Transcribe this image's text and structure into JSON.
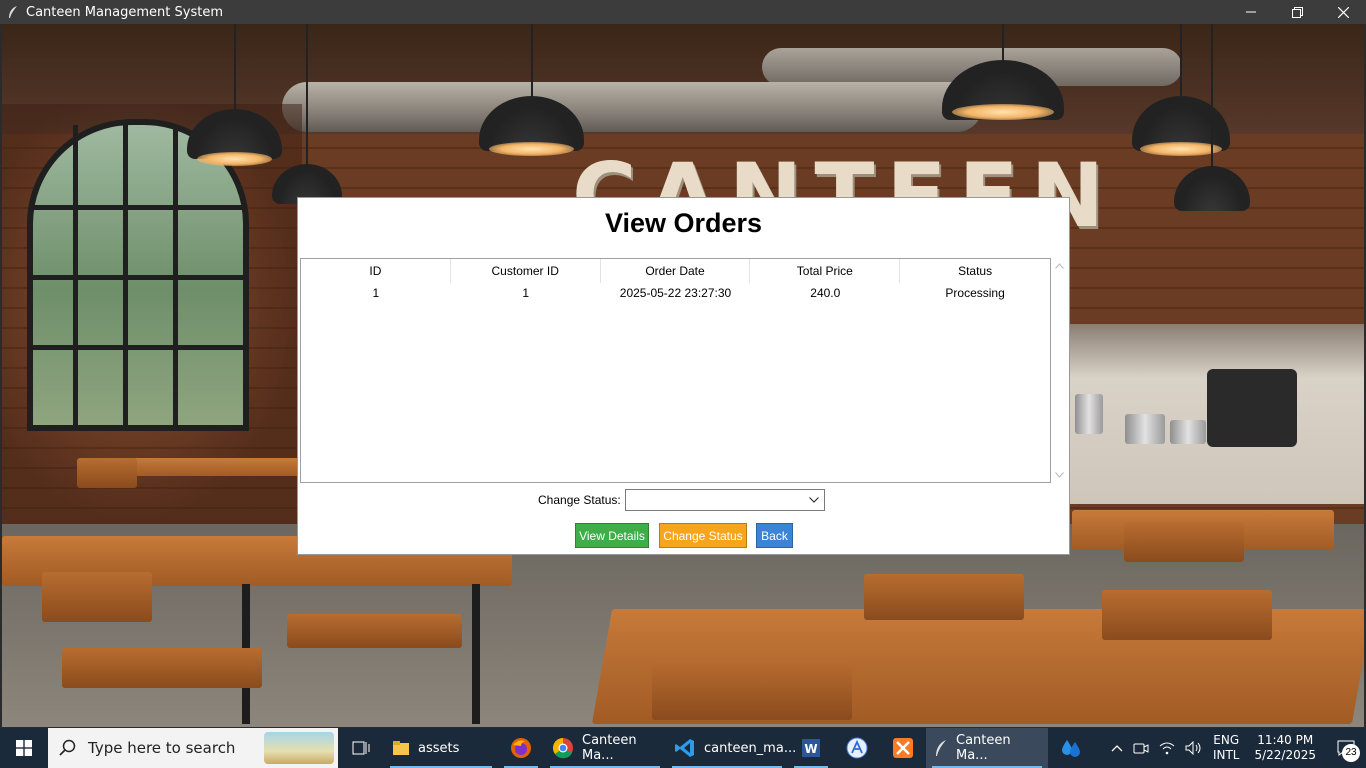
{
  "window": {
    "title": "Canteen Management System",
    "minimize_icon": "minimize-icon",
    "maximize_icon": "restore-icon",
    "close_icon": "close-icon"
  },
  "background": {
    "sign_text": "CANTEEN"
  },
  "dialog": {
    "title": "View Orders",
    "table": {
      "columns": [
        "ID",
        "Customer ID",
        "Order Date",
        "Total Price",
        "Status"
      ],
      "rows": [
        [
          "1",
          "1",
          "2025-05-22 23:27:30",
          "240.0",
          "Processing"
        ]
      ]
    },
    "change_status_label": "Change Status:",
    "change_status_value": "",
    "buttons": {
      "view_details": "View Details",
      "change_status": "Change Status",
      "back": "Back"
    },
    "colors": {
      "view_details": "#3fae49",
      "change_status": "#f7a51c",
      "back": "#3b84d6"
    }
  },
  "taskbar": {
    "search_placeholder": "Type here to search",
    "apps": [
      {
        "label": "assets",
        "icon": "folder-icon"
      },
      {
        "label": "",
        "icon": "firefox-icon"
      },
      {
        "label": "Canteen Ma...",
        "icon": "chrome-icon"
      },
      {
        "label": "canteen_ma...",
        "icon": "vscode-icon"
      },
      {
        "label": "",
        "icon": "word-icon"
      },
      {
        "label": "",
        "icon": "app-store-icon"
      },
      {
        "label": "",
        "icon": "xampp-icon"
      },
      {
        "label": "Canteen Ma...",
        "icon": "python-feather-icon"
      },
      {
        "label": "",
        "icon": "water-drop-icon"
      }
    ],
    "tray": {
      "lang_top": "ENG",
      "lang_bottom": "INTL",
      "time": "11:40 PM",
      "date": "5/22/2025",
      "notification_count": "23"
    }
  }
}
